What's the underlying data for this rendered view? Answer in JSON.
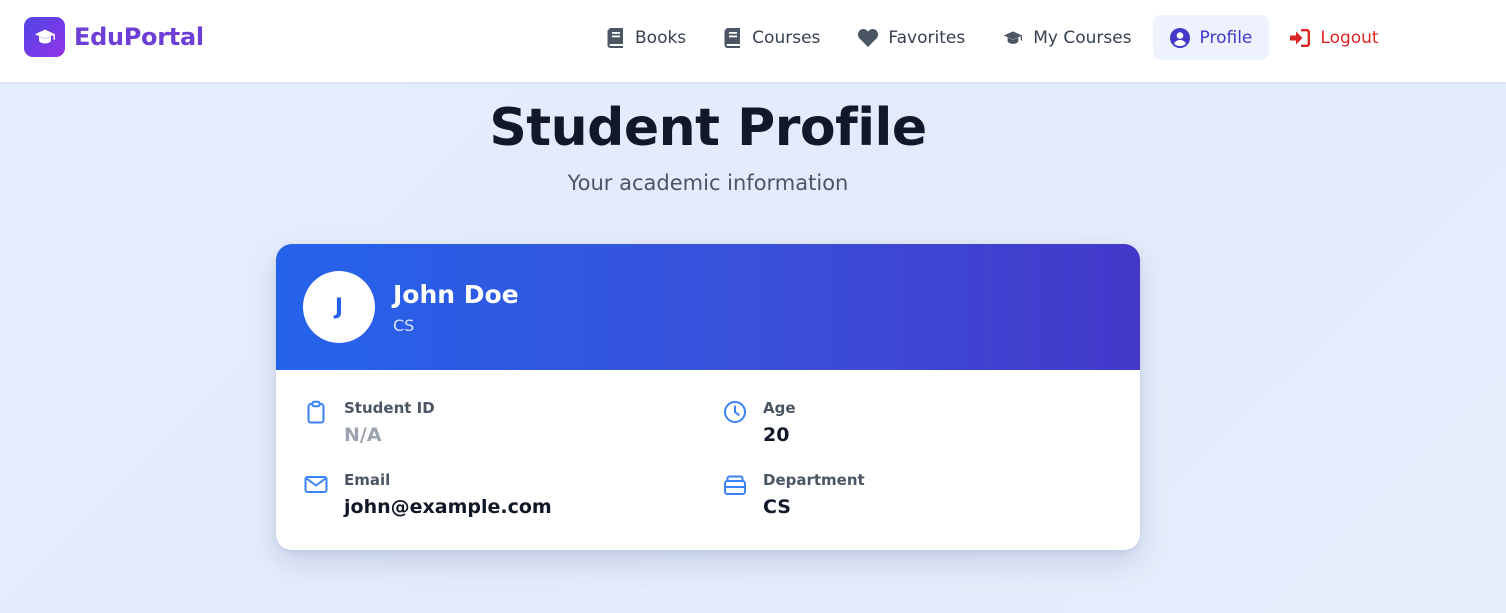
{
  "brand": {
    "name": "EduPortal",
    "logo_icon": "graduation-cap-icon"
  },
  "nav": {
    "items": [
      {
        "label": "Books",
        "icon": "book-icon"
      },
      {
        "label": "Courses",
        "icon": "book-icon"
      },
      {
        "label": "Favorites",
        "icon": "heart-icon"
      },
      {
        "label": "My Courses",
        "icon": "graduation-cap-icon"
      },
      {
        "label": "Profile",
        "icon": "user-circle-icon",
        "active": true
      },
      {
        "label": "Logout",
        "icon": "sign-out-icon"
      }
    ]
  },
  "page": {
    "title": "Student Profile",
    "subtitle": "Your academic information"
  },
  "profile": {
    "avatar_initial": "J",
    "name": "John Doe",
    "department_short": "CS",
    "fields": [
      {
        "label": "Student ID",
        "value": "N/A",
        "icon": "clipboard-icon"
      },
      {
        "label": "Age",
        "value": "20",
        "icon": "clock-icon"
      },
      {
        "label": "Email",
        "value": "john@example.com",
        "icon": "mail-icon"
      },
      {
        "label": "Department",
        "value": "CS",
        "icon": "briefcase-icon"
      }
    ]
  },
  "colors": {
    "brand": "#6d3fd6",
    "accent": "#2563eb",
    "header_gradient_start": "#2563eb",
    "header_gradient_end": "#4338ca",
    "logout": "#dc2626",
    "active_nav_bg": "#eef2ff"
  }
}
